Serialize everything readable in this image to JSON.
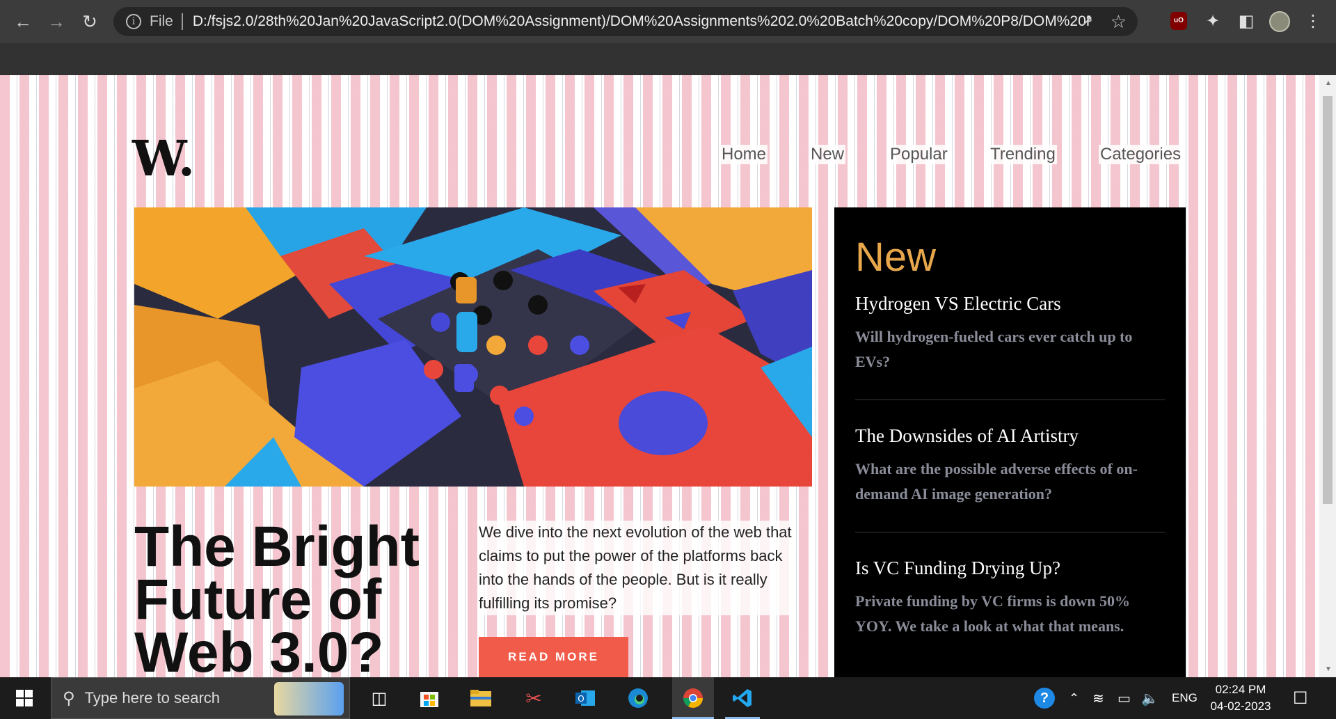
{
  "browser": {
    "url_scheme_label": "File",
    "url": "D:/fsjs2.0/28th%20Jan%20JavaScript2.0(DOM%20Assignment)/DOM%20Assignments%202.0%20Batch%20copy/DOM%20P8/DOM%20P8..."
  },
  "site": {
    "logo": "W.",
    "nav": [
      "Home",
      "New",
      "Popular",
      "Trending",
      "Categories"
    ]
  },
  "main": {
    "headline": "The Bright Future of Web 3.0?",
    "blurb": "We dive into the next evolution of the web that claims to put the power of the platforms back into the hands of the people. But is it really fulfilling its promise?",
    "cta": "READ MORE"
  },
  "sidebar": {
    "heading": "New",
    "articles": [
      {
        "title": "Hydrogen VS Electric Cars",
        "desc": "Will hydrogen-fueled cars ever catch up to EVs?"
      },
      {
        "title": "The Downsides of AI Artistry",
        "desc": "What are the possible adverse effects of on-demand AI image generation?"
      },
      {
        "title": "Is VC Funding Drying Up?",
        "desc": "Private funding by VC firms is down 50% YOY. We take a look at what that means."
      }
    ]
  },
  "taskbar": {
    "search_placeholder": "Type here to search",
    "lang": "ENG",
    "time": "02:24 PM",
    "date": "04-02-2023"
  },
  "colors": {
    "accent": "#e9a74b",
    "cta": "#f15b4a",
    "sidebar_bg": "#000000"
  }
}
